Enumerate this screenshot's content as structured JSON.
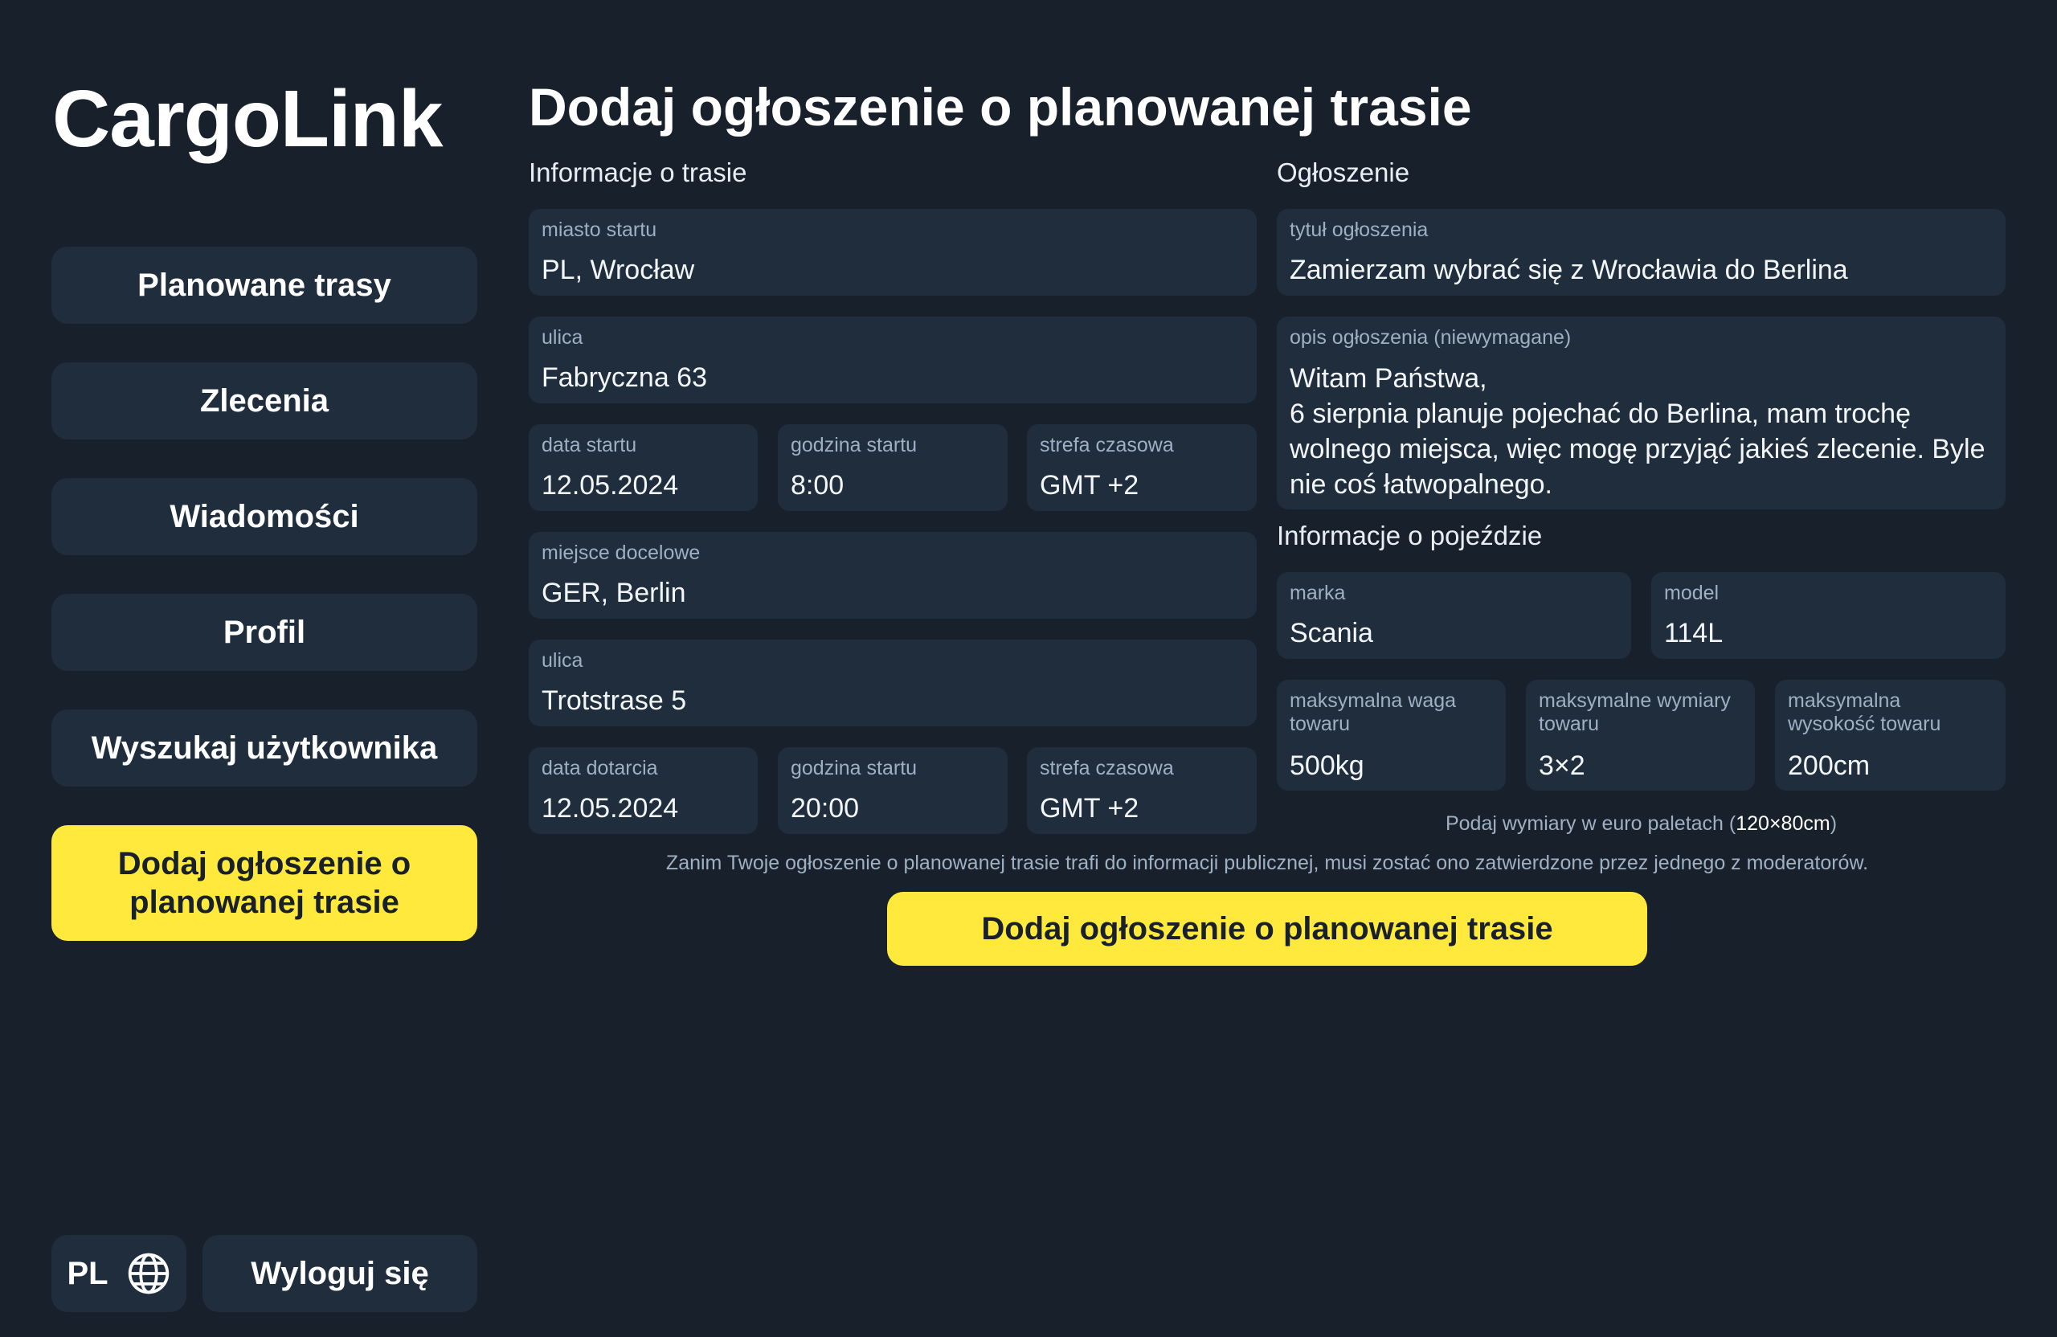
{
  "app": {
    "logo": "CargoLink"
  },
  "sidebar": {
    "items": [
      {
        "label": "Planowane trasy"
      },
      {
        "label": "Zlecenia"
      },
      {
        "label": "Wiadomości"
      },
      {
        "label": "Profil"
      },
      {
        "label": "Wyszukaj użytkownika"
      },
      {
        "label": "Dodaj ogłoszenie o planowanej trasie",
        "active": true
      }
    ],
    "language": "PL",
    "language_icon": "globe-icon",
    "logout_label": "Wyloguj się"
  },
  "page": {
    "title": "Dodaj ogłoszenie o planowanej trasie"
  },
  "route_info": {
    "section_label": "Informacje o trasie",
    "start_city": {
      "label": "miasto startu",
      "value": "PL, Wrocław"
    },
    "start_street": {
      "label": "ulica",
      "value": "Fabryczna 63"
    },
    "start_date": {
      "label": "data startu",
      "value": "12.05.2024"
    },
    "start_time": {
      "label": "godzina startu",
      "value": "8:00"
    },
    "start_timezone": {
      "label": "strefa czasowa",
      "value": "GMT +2"
    },
    "destination": {
      "label": "miejsce docelowe",
      "value": "GER, Berlin"
    },
    "dest_street": {
      "label": "ulica",
      "value": "Trotstrase 5"
    },
    "arrival_date": {
      "label": "data dotarcia",
      "value": "12.05.2024"
    },
    "arrival_time": {
      "label": "godzina startu",
      "value": "20:00"
    },
    "arrival_timezone": {
      "label": "strefa czasowa",
      "value": "GMT +2"
    }
  },
  "announcement": {
    "section_label": "Ogłoszenie",
    "title": {
      "label": "tytuł ogłoszenia",
      "value": "Zamierzam wybrać się z Wrocławia do Berlina"
    },
    "description": {
      "label": "opis ogłoszenia (niewymagane)",
      "value": "Witam Państwa,\n6 sierpnia planuje pojechać do Berlina, mam trochę wolnego miejsca, więc mogę przyjąć jakieś zlecenie. Byle nie coś łatwopalnego."
    }
  },
  "vehicle": {
    "section_label": "Informacje o pojeździe",
    "brand": {
      "label": "marka",
      "value": "Scania"
    },
    "model": {
      "label": "model",
      "value": "114L"
    },
    "max_weight": {
      "label": "maksymalna waga towaru",
      "value": "500kg"
    },
    "max_dimensions": {
      "label": "maksymalne wymiary towaru",
      "value": "3×2"
    },
    "max_height": {
      "label": "maksymalna wysokość towaru",
      "value": "200cm"
    },
    "pallet_hint_prefix": "Podaj wymiary w euro paletach (",
    "pallet_hint_value": "120×80cm",
    "pallet_hint_suffix": ")"
  },
  "footer": {
    "moderation_note": "Zanim Twoje ogłoszenie o planowanej trasie trafi do informacji publicznej, musi zostać ono zatwierdzone przez jednego z moderatorów.",
    "submit_label": "Dodaj ogłoszenie o planowanej trasie"
  },
  "colors": {
    "background": "#18212b",
    "field": "#1f2d3d",
    "accent": "#ffe93c",
    "label": "#9fb0c2"
  }
}
